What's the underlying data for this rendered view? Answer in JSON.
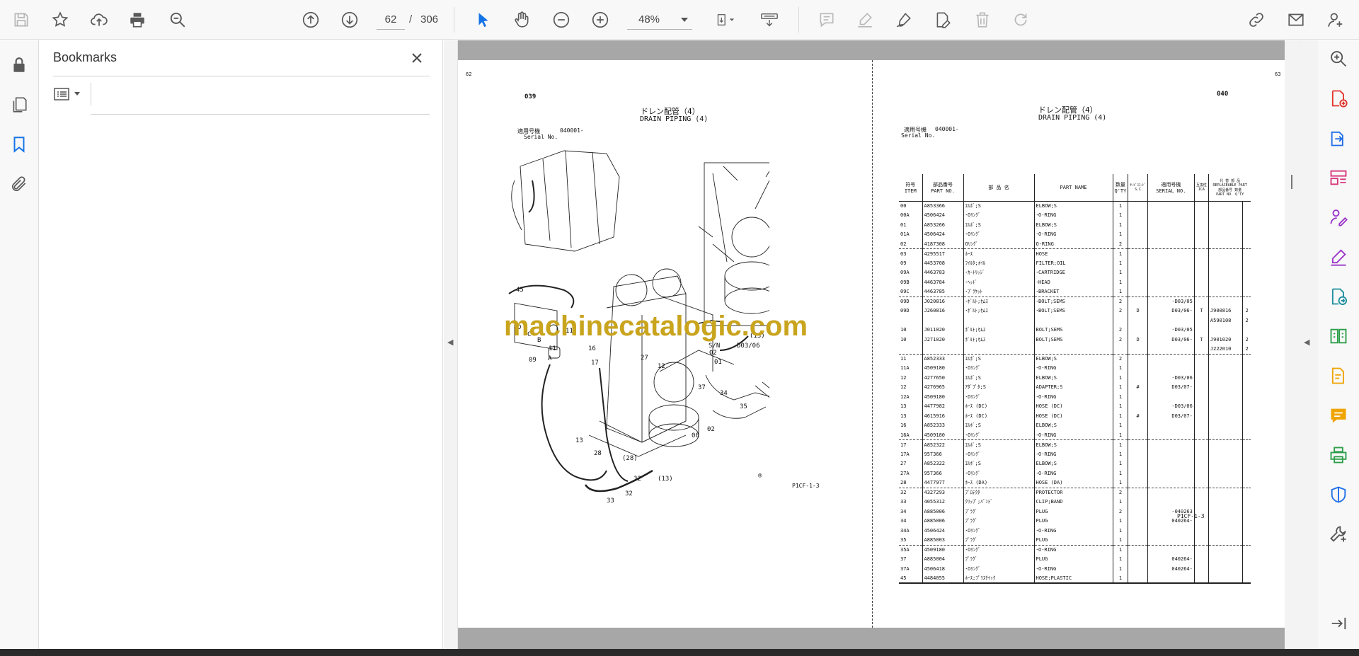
{
  "toolbar": {
    "page_current": "62",
    "page_separator": "/",
    "page_total": "306",
    "zoom": "48%"
  },
  "bookmarks": {
    "title": "Bookmarks"
  },
  "document": {
    "left_page_number": "62",
    "right_page_number": "63",
    "left_figure_no": "039",
    "right_figure_no": "040",
    "title_jp": "ドレン配管（4）",
    "title_en": "DRAIN PIPING (4)",
    "serial_label_jp": "適用号機",
    "serial_value": "040001-",
    "serial_label_en": "Serial No.",
    "footer_code": "P1CF-1-3",
    "watermark": "machinecatalogic.com",
    "diagram_labels": [
      "45",
      "D",
      "C",
      "B",
      "A",
      "11",
      "09",
      "16",
      "17",
      "27",
      "12",
      "02",
      "01",
      "37",
      "34",
      "35",
      "13",
      "28",
      "(28)",
      "32",
      "33",
      "32",
      "(13)",
      "00",
      "02",
      "12",
      "(13)",
      "S/N",
      "D03/06"
    ],
    "table_headers": {
      "item_jp": "符号",
      "item_en": "ITEM",
      "part_jp": "部品番号",
      "part_en": "PART NO.",
      "name_jp": "部 品 名",
      "name_en": "PART NAME",
      "qty_jp": "数量",
      "qty_en": "Q'TY",
      "sc_jp": "ｻｰﾋﾞｽｺｰﾄﾞ",
      "sc_en": "S.C",
      "serial_jp": "適用号機",
      "serial_en": "SERIAL NO.",
      "ic_jp": "互換性",
      "ic_en": "ICA",
      "repl_jp": "代 替 部 品",
      "repl_en": "REPLACEABLE PART",
      "repl_part_jp": "部品番号",
      "repl_part_en": "PART NO.",
      "repl_qty_jp": "数量",
      "repl_qty_en": "Q'TY"
    },
    "rows": [
      [
        "00",
        "A853366",
        "ｴﾙﾎﾞ;S",
        "ELBOW;S",
        "1",
        "",
        "",
        "",
        "",
        ""
      ],
      [
        "00A",
        "4506424",
        "･Oﾘﾝｸﾞ",
        "･O-RING",
        "1",
        "",
        "",
        "",
        "",
        ""
      ],
      [
        "01",
        "A853266",
        "ｴﾙﾎﾞ;S",
        "ELBOW;S",
        "1",
        "",
        "",
        "",
        "",
        ""
      ],
      [
        "01A",
        "4506424",
        "･Oﾘﾝｸﾞ",
        "･O-RING",
        "1",
        "",
        "",
        "",
        "",
        ""
      ],
      [
        "02",
        "4187308",
        "Oﾘﾝｸﾞ",
        "O-RING",
        "2",
        "",
        "",
        "",
        "",
        ""
      ],
      [
        "03",
        "4295517",
        "ﾎｰｽ",
        "HOSE",
        "1",
        "",
        "",
        "",
        "",
        ""
      ],
      [
        "09",
        "4453708",
        "ﾌｲﾙﾀ;ｵｲﾙ",
        "FILTER;OIL",
        "1",
        "",
        "",
        "",
        "",
        ""
      ],
      [
        "09A",
        "4463783",
        "･ｶｰﾄﾘｯｼﾞ",
        "･CARTRIDGE",
        "1",
        "",
        "",
        "",
        "",
        ""
      ],
      [
        "09B",
        "4463784",
        "･ﾍｯﾄﾞ",
        "･HEAD",
        "1",
        "",
        "",
        "",
        "",
        ""
      ],
      [
        "09C",
        "4463785",
        "･ﾌﾞﾗｹｯﾄ",
        "･BRACKET",
        "1",
        "",
        "",
        "",
        "",
        ""
      ],
      [
        "09D",
        "J020816",
        "･ﾎﾞﾙﾄ;ｾﾑｽ",
        "･BOLT;SEMS",
        "2",
        "",
        "-D03/05",
        "",
        "",
        ""
      ],
      [
        "09D",
        "J260816",
        "･ﾎﾞﾙﾄ;ｾﾑｽ",
        "･BOLT;SEMS",
        "2",
        "D",
        "D03/06-",
        "T",
        "J900816",
        "2"
      ],
      [
        "",
        "",
        "",
        "",
        "",
        "",
        "",
        "",
        "A590108",
        "2"
      ],
      [
        "10",
        "J011020",
        "ﾎﾞﾙﾄ;ｾﾑｽ",
        "BOLT;SEMS",
        "2",
        "",
        "-D03/05",
        "",
        "",
        ""
      ],
      [
        "10",
        "J271020",
        "ﾎﾞﾙﾄ;ｾﾑｽ",
        "BOLT;SEMS",
        "2",
        "D",
        "D03/06-",
        "T",
        "J901020",
        "2"
      ],
      [
        "",
        "",
        "",
        "",
        "",
        "",
        "",
        "",
        "J222010",
        "2"
      ],
      [
        "11",
        "A852333",
        "ｴﾙﾎﾞ;S",
        "ELBOW;S",
        "2",
        "",
        "",
        "",
        "",
        ""
      ],
      [
        "11A",
        "4509180",
        "･Oﾘﾝｸﾞ",
        "･O-RING",
        "1",
        "",
        "",
        "",
        "",
        ""
      ],
      [
        "12",
        "4277650",
        "ｴﾙﾎﾞ;S",
        "ELBOW;S",
        "1",
        "",
        "-D03/06",
        "",
        "",
        ""
      ],
      [
        "12",
        "4276965",
        "ｱﾀﾞﾌﾟﾀ;S",
        "ADAPTER;S",
        "1",
        "#",
        "D03/07-",
        "",
        "",
        ""
      ],
      [
        "12A",
        "4509180",
        "･Oﾘﾝｸﾞ",
        "･O-RING",
        "1",
        "",
        "",
        "",
        "",
        ""
      ],
      [
        "13",
        "4477982",
        "ﾎｰｽ (DC)",
        "HOSE (DC)",
        "1",
        "",
        "-D03/06",
        "",
        "",
        ""
      ],
      [
        "13",
        "4615916",
        "ﾎｰｽ (DC)",
        "HOSE (DC)",
        "1",
        "#",
        "D03/07-",
        "",
        "",
        ""
      ],
      [
        "16",
        "A852333",
        "ｴﾙﾎﾞ;S",
        "ELBOW;S",
        "1",
        "",
        "",
        "",
        "",
        ""
      ],
      [
        "16A",
        "4509180",
        "･Oﾘﾝｸﾞ",
        "･O-RING",
        "1",
        "",
        "",
        "",
        "",
        ""
      ],
      [
        "17",
        "A852322",
        "ｴﾙﾎﾞ;S",
        "ELBOW;S",
        "1",
        "",
        "",
        "",
        "",
        ""
      ],
      [
        "17A",
        "957366",
        "･Oﾘﾝｸﾞ",
        "･O-RING",
        "1",
        "",
        "",
        "",
        "",
        ""
      ],
      [
        "27",
        "A852322",
        "ｴﾙﾎﾞ;S",
        "ELBOW;S",
        "1",
        "",
        "",
        "",
        "",
        ""
      ],
      [
        "27A",
        "957366",
        "･Oﾘﾝｸﾞ",
        "･O-RING",
        "1",
        "",
        "",
        "",
        "",
        ""
      ],
      [
        "28",
        "4477977",
        "ﾎｰｽ (DA)",
        "HOSE (DA)",
        "1",
        "",
        "",
        "",
        "",
        ""
      ],
      [
        "32",
        "4327293",
        "ﾌﾟﾛﾃｸﾀ",
        "PROTECTOR",
        "2",
        "",
        "",
        "",
        "",
        ""
      ],
      [
        "33",
        "4055312",
        "ｸﾘｯﾌﾟ;ﾊﾞﾝﾄﾞ",
        "CLIP;BAND",
        "1",
        "",
        "",
        "",
        "",
        ""
      ],
      [
        "34",
        "A885006",
        "ﾌﾟﾗｸﾞ",
        "PLUG",
        "2",
        "",
        "-040263",
        "",
        "",
        ""
      ],
      [
        "34",
        "A885006",
        "ﾌﾟﾗｸﾞ",
        "PLUG",
        "1",
        "",
        "040264-",
        "",
        "",
        ""
      ],
      [
        "34A",
        "4506424",
        "･Oﾘﾝｸﾞ",
        "･O-RING",
        "1",
        "",
        "",
        "",
        "",
        ""
      ],
      [
        "35",
        "A885003",
        "ﾌﾟﾗｸﾞ",
        "PLUG",
        "1",
        "",
        "",
        "",
        "",
        ""
      ],
      [
        "35A",
        "4509180",
        "･Oﾘﾝｸﾞ",
        "･O-RING",
        "1",
        "",
        "",
        "",
        "",
        ""
      ],
      [
        "37",
        "A885004",
        "ﾌﾟﾗｸﾞ",
        "PLUG",
        "1",
        "",
        "040264-",
        "",
        "",
        ""
      ],
      [
        "37A",
        "4506418",
        "･Oﾘﾝｸﾞ",
        "･O-RING",
        "1",
        "",
        "040264-",
        "",
        "",
        ""
      ],
      [
        "45",
        "4484055",
        "ﾎｰｽ;ﾌﾟﾗｽﾁｲｯｸ",
        "HOSE;PLASTIC",
        "1",
        "",
        "",
        "",
        "",
        ""
      ]
    ],
    "separator_after": [
      4,
      9,
      15,
      24,
      29,
      35
    ],
    "circle_r_mark": "®"
  }
}
